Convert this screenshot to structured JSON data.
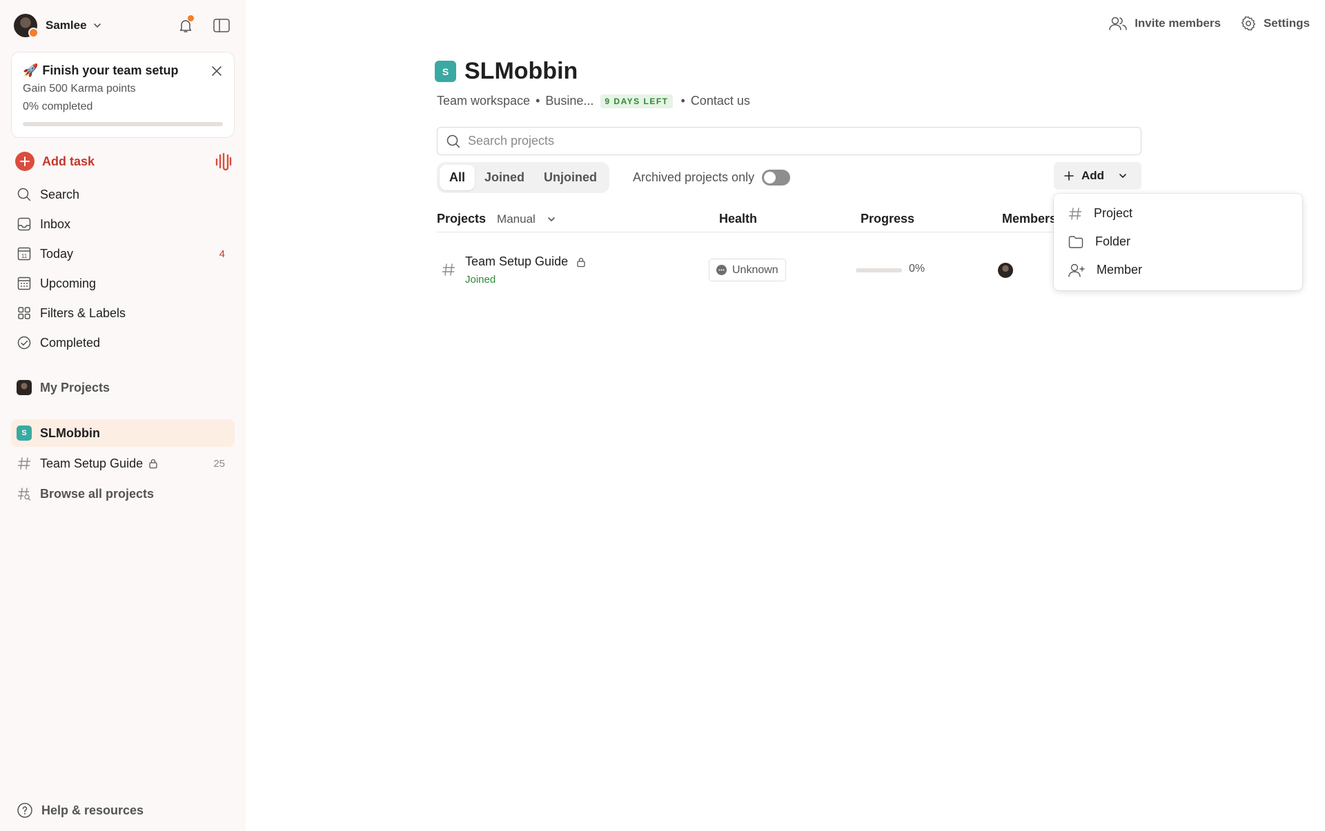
{
  "sidebar": {
    "user_name": "Samlee",
    "setup_card": {
      "emoji": "🚀",
      "title": "Finish your team setup",
      "subtitle": "Gain 500 Karma points",
      "progress_text": "0% completed",
      "progress": 0
    },
    "add_task_label": "Add task",
    "nav": [
      {
        "label": "Search",
        "icon": "search-icon"
      },
      {
        "label": "Inbox",
        "icon": "inbox-icon"
      },
      {
        "label": "Today",
        "icon": "calendar-today-icon",
        "count": "4"
      },
      {
        "label": "Upcoming",
        "icon": "calendar-grid-icon"
      },
      {
        "label": "Filters & Labels",
        "icon": "grid-icon"
      },
      {
        "label": "Completed",
        "icon": "check-circle-icon"
      }
    ],
    "my_projects_label": "My Projects",
    "workspace": {
      "badge": "S",
      "label": "SLMobbin",
      "project_label": "Team Setup Guide",
      "project_count": "25",
      "browse_label": "Browse all projects"
    },
    "help_label": "Help & resources"
  },
  "top_actions": {
    "invite_label": "Invite members",
    "settings_label": "Settings"
  },
  "workspace": {
    "badge": "S",
    "title": "SLMobbin",
    "meta_type": "Team workspace",
    "meta_plan": "Busine...",
    "trial_badge": "9 DAYS LEFT",
    "contact": "Contact us"
  },
  "search": {
    "placeholder": "Search projects",
    "value": ""
  },
  "filters": {
    "tabs": [
      "All",
      "Joined",
      "Unjoined"
    ],
    "selected": "All",
    "archived_label": "Archived projects only",
    "archived_on": false
  },
  "add_button": {
    "label": "Add"
  },
  "table": {
    "headers": {
      "projects": "Projects",
      "sort": "Manual",
      "health": "Health",
      "progress": "Progress",
      "members": "Members"
    },
    "rows": [
      {
        "name": "Team Setup Guide",
        "status": "Joined",
        "health": "Unknown",
        "progress_text": "0%",
        "progress": 0
      }
    ]
  },
  "add_menu": {
    "items": [
      {
        "label": "Project",
        "icon": "hash-icon"
      },
      {
        "label": "Folder",
        "icon": "folder-icon"
      },
      {
        "label": "Member",
        "icon": "add-user-icon"
      }
    ]
  },
  "colors": {
    "accent": "#dc4c3e",
    "workspace_badge": "#3aa9a2",
    "joined_green": "#2a8a32",
    "notification": "#f57e2a",
    "active_nav_bg": "#fdeee4"
  }
}
